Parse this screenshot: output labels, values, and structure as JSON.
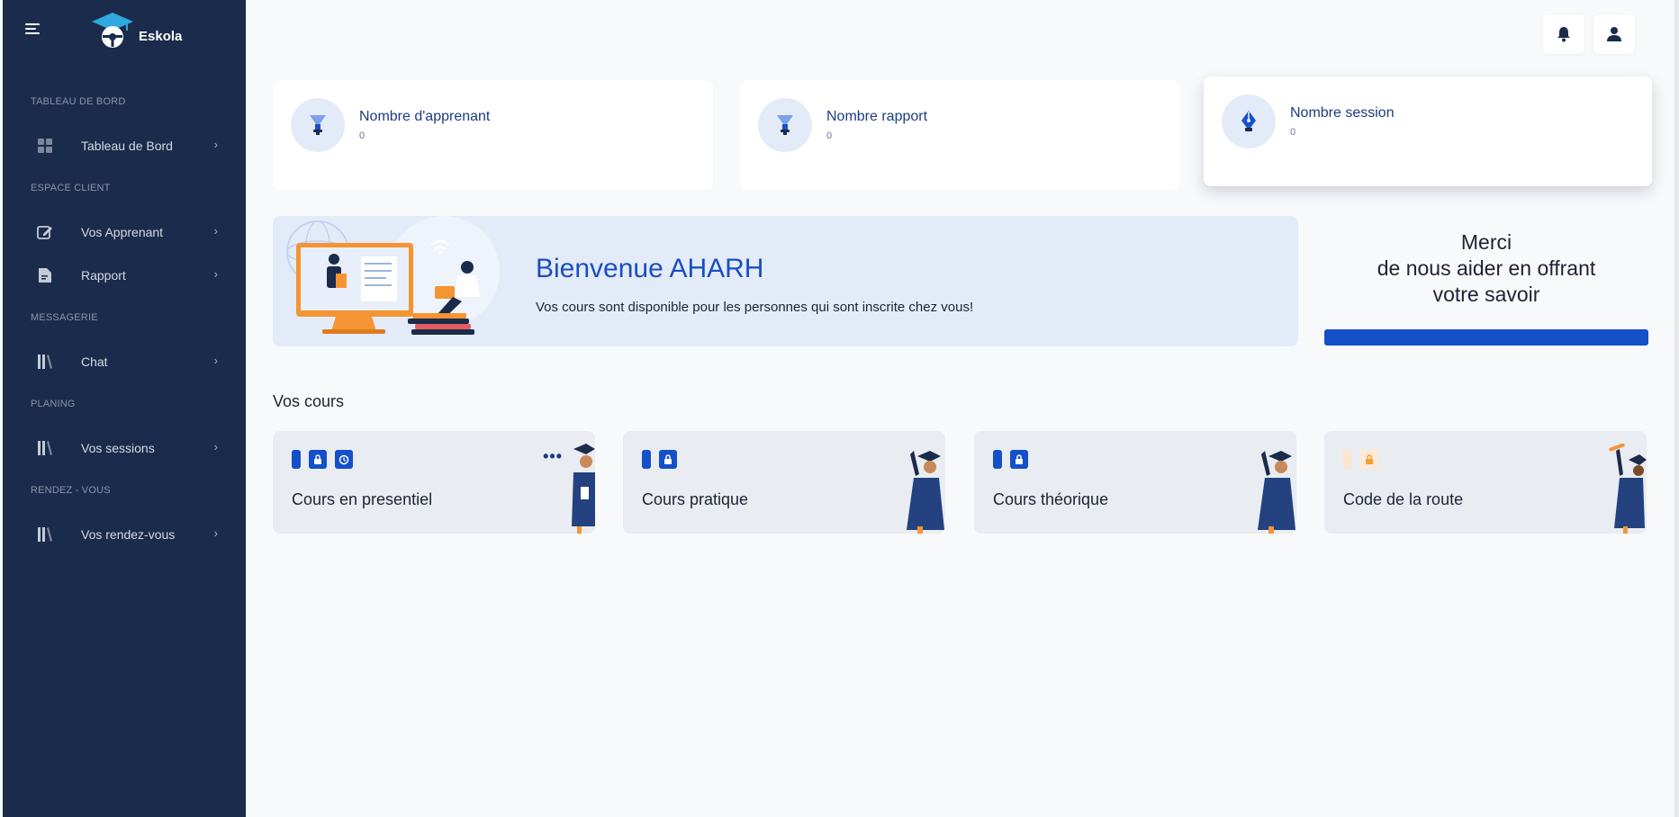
{
  "brand": {
    "name": "Eskola"
  },
  "sidebar": {
    "sections": [
      {
        "title": "TABLEAU DE BORD",
        "items": [
          {
            "label": "Tableau de Bord",
            "icon": "grid-icon"
          }
        ]
      },
      {
        "title": "ESPACE CLIENT",
        "items": [
          {
            "label": "Vos Apprenant",
            "icon": "edit-icon"
          },
          {
            "label": "Rapport",
            "icon": "document-icon"
          }
        ]
      },
      {
        "title": "MESSAGERIE",
        "items": [
          {
            "label": "Chat",
            "icon": "books-icon"
          }
        ]
      },
      {
        "title": "PLANING",
        "items": [
          {
            "label": "Vos sessions",
            "icon": "books-icon"
          }
        ]
      },
      {
        "title": "RENDEZ - VOUS",
        "items": [
          {
            "label": "Vos rendez-vous",
            "icon": "books-icon"
          }
        ]
      }
    ]
  },
  "stats": [
    {
      "title": "Nombre d'apprenant",
      "value": "0",
      "icon": "lamp-icon"
    },
    {
      "title": "Nombre rapport",
      "value": "0",
      "icon": "lamp-icon"
    },
    {
      "title": "Nombre session",
      "value": "0",
      "icon": "pen-nib-icon"
    }
  ],
  "welcome": {
    "title": "Bienvenue AHARH",
    "subtitle": "Vos cours sont disponible pour les personnes qui sont inscrite chez vous!"
  },
  "thanks": {
    "line1": "Merci",
    "line2": "de nous aider en offrant",
    "line3": "votre savoir"
  },
  "courses_section": {
    "title": "Vos cours"
  },
  "courses": [
    {
      "name": "Cours en presentiel"
    },
    {
      "name": "Cours pratique"
    },
    {
      "name": "Cours théorique"
    },
    {
      "name": "Code de la route"
    }
  ],
  "colors": {
    "sidebar": "#1b2b4b",
    "accent": "#1450c8",
    "card": "#ffffff",
    "course_bg": "#e9ecf1"
  }
}
